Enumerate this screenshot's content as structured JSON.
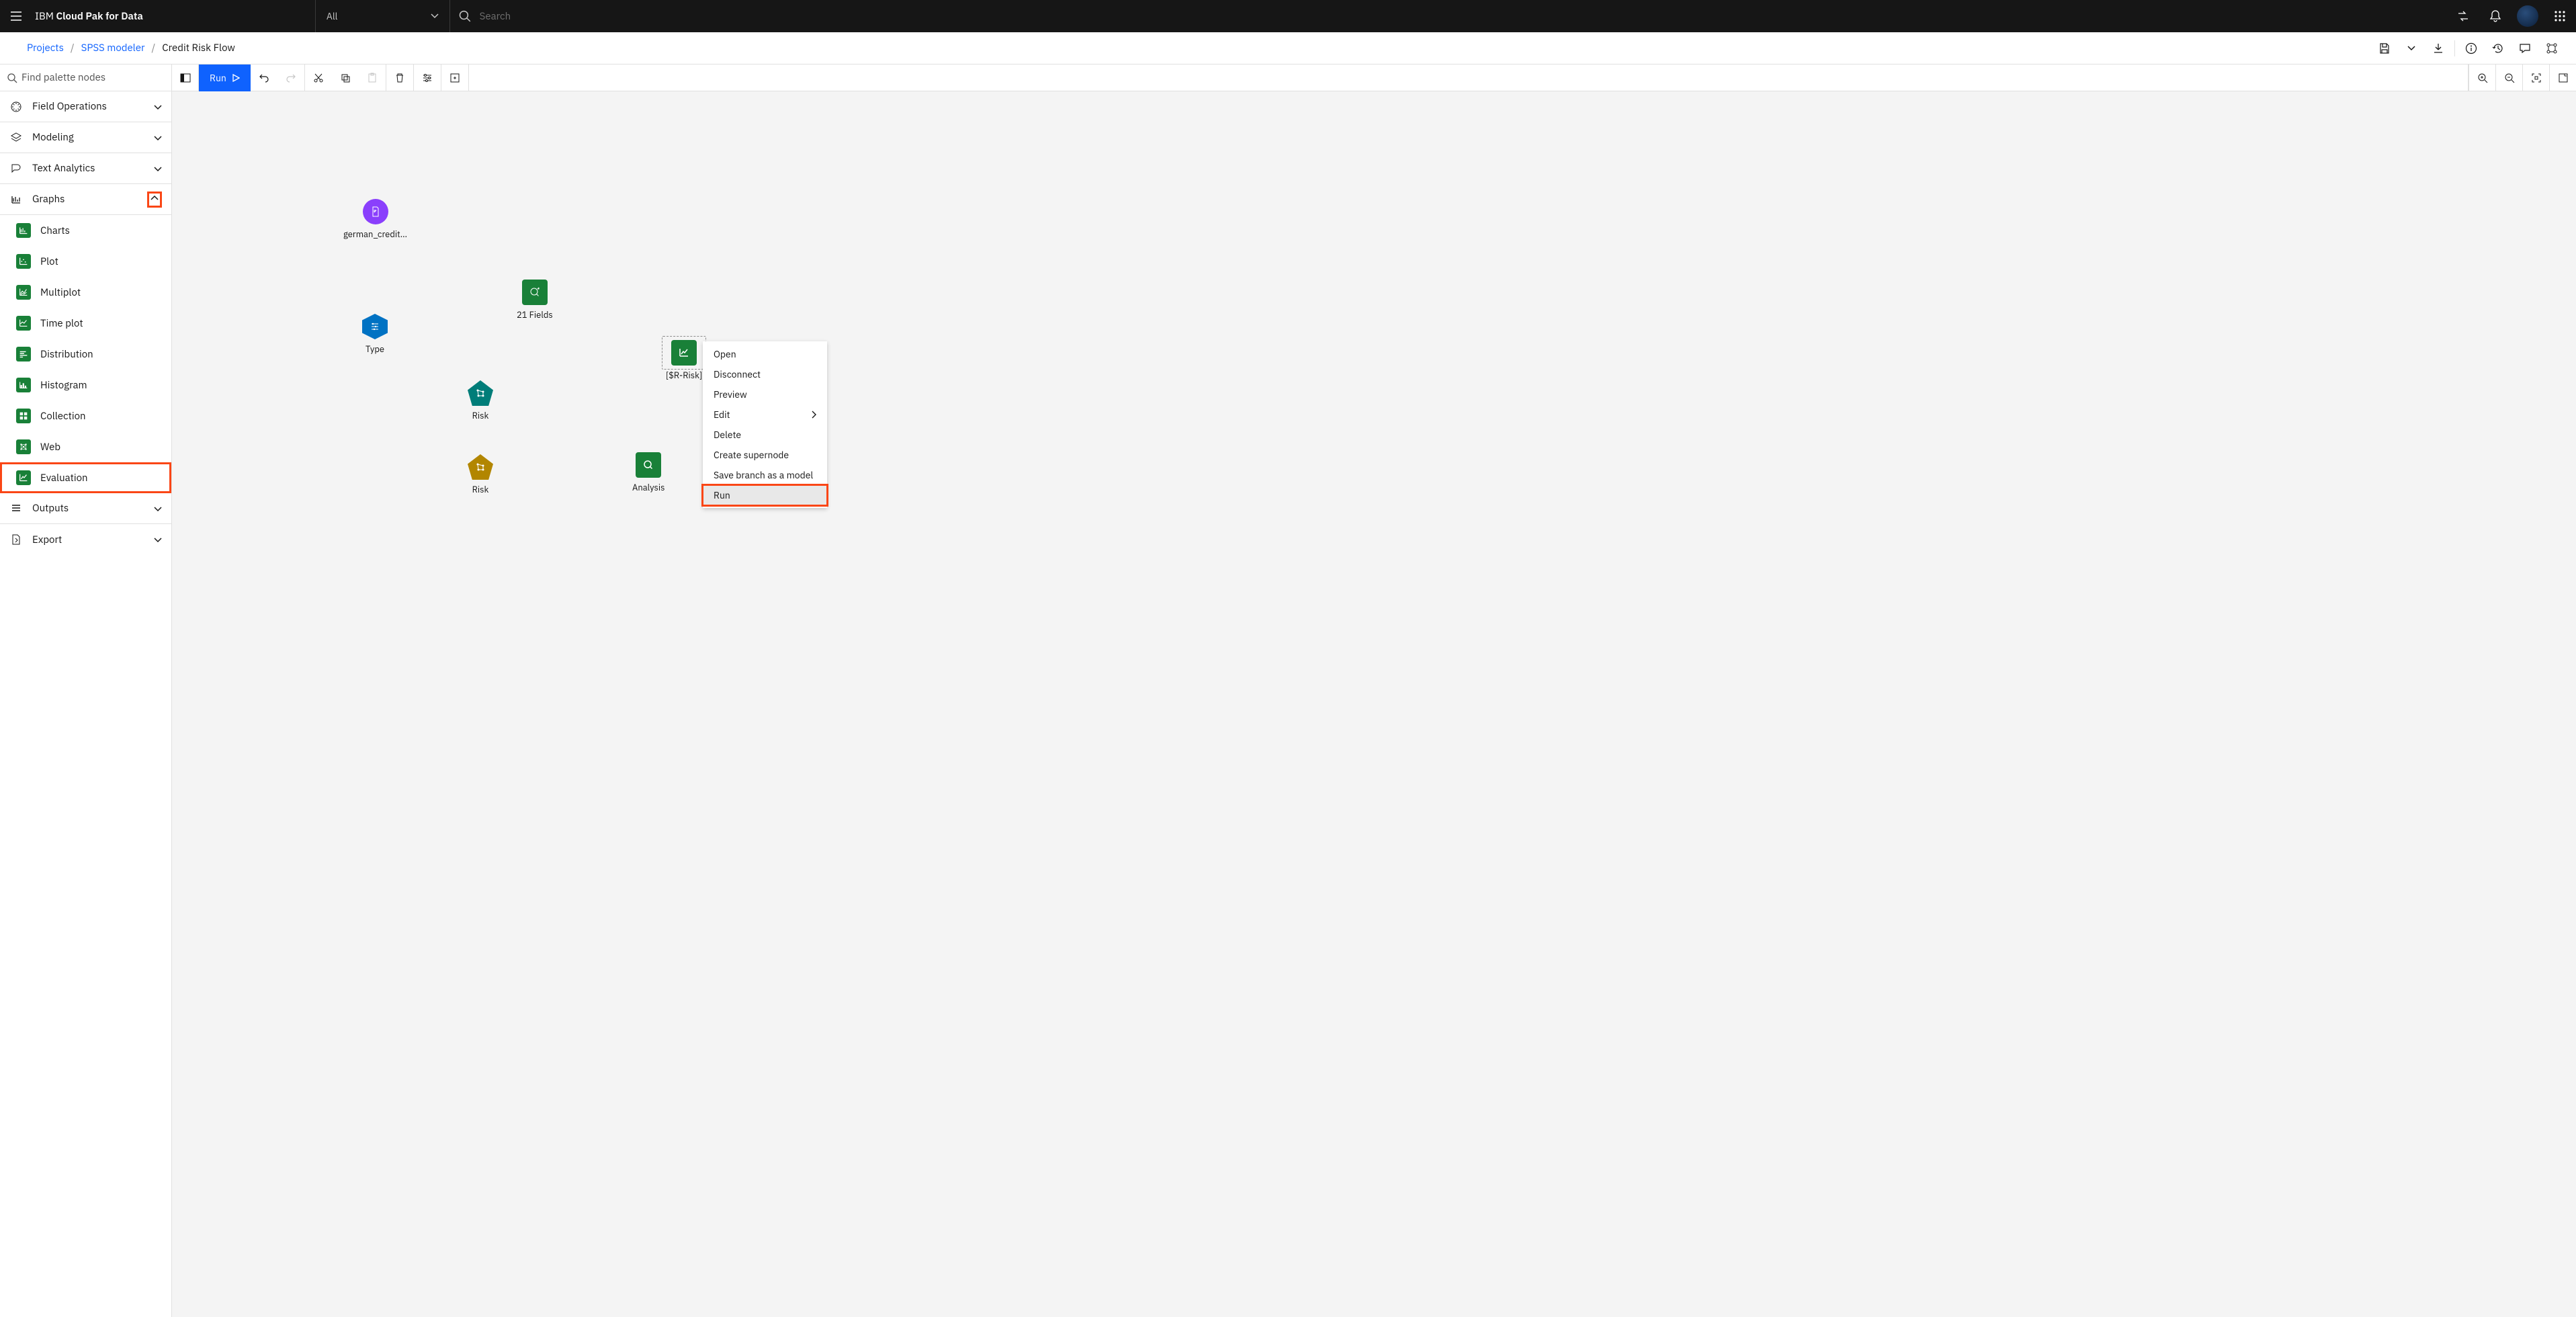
{
  "topbar": {
    "brand_prefix": "IBM ",
    "brand_main": "Cloud Pak for Data",
    "all_label": "All",
    "search_placeholder": "Search"
  },
  "crumbs": {
    "projects": "Projects",
    "modeler": "SPSS modeler",
    "flow": "Credit Risk Flow"
  },
  "toolbar": {
    "palette_placeholder": "Find palette nodes",
    "run_label": "Run"
  },
  "sidebar": {
    "cats": {
      "field_ops": "Field Operations",
      "modeling": "Modeling",
      "text_analytics": "Text Analytics",
      "graphs": "Graphs",
      "outputs": "Outputs",
      "export": "Export"
    },
    "graph_items": [
      "Charts",
      "Plot",
      "Multiplot",
      "Time plot",
      "Distribution",
      "Histogram",
      "Collection",
      "Web",
      "Evaluation"
    ]
  },
  "canvas": {
    "nodes": {
      "source": "german_credit…",
      "type": "Type",
      "fields21": "21 Fields",
      "risk1": "Risk",
      "risk2": "Risk",
      "analysis": "Analysis",
      "eval": "[$R-Risk]"
    }
  },
  "ctx": {
    "open": "Open",
    "disconnect": "Disconnect",
    "preview": "Preview",
    "edit": "Edit",
    "delete": "Delete",
    "supernode": "Create supernode",
    "savebranch": "Save branch as a model",
    "run": "Run"
  }
}
